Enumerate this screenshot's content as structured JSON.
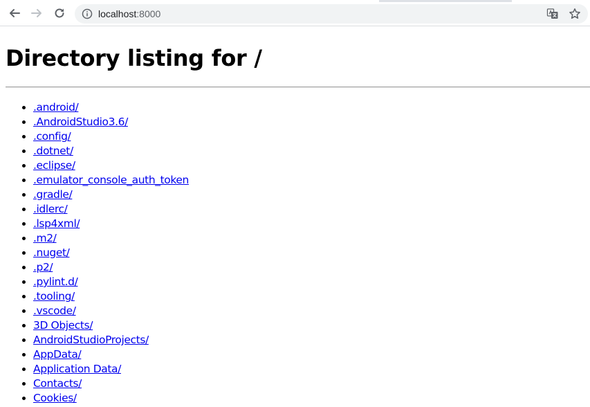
{
  "browser": {
    "url_host": "localhost",
    "url_port": ":8000",
    "icons": {
      "back": "back-arrow-icon",
      "forward": "forward-arrow-icon",
      "reload": "reload-icon",
      "site_info": "info-icon",
      "translate": "translate-icon",
      "bookmark": "star-icon"
    }
  },
  "page": {
    "title": "Directory listing for /",
    "link_color": "#0000ee",
    "entries": [
      ".android/",
      ".AndroidStudio3.6/",
      ".config/",
      ".dotnet/",
      ".eclipse/",
      ".emulator_console_auth_token",
      ".gradle/",
      ".idlerc/",
      ".lsp4xml/",
      ".m2/",
      ".nuget/",
      ".p2/",
      ".pylint.d/",
      ".tooling/",
      ".vscode/",
      "3D Objects/",
      "AndroidStudioProjects/",
      "AppData/",
      "Application Data/",
      "Contacts/",
      "Cookies/"
    ]
  }
}
